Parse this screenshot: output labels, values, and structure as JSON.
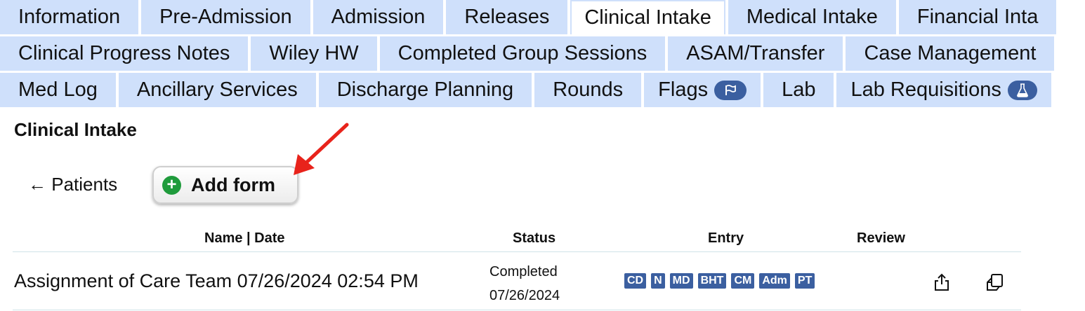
{
  "tabs": {
    "row1": [
      {
        "label": "Information"
      },
      {
        "label": "Pre-Admission"
      },
      {
        "label": "Admission"
      },
      {
        "label": "Releases"
      },
      {
        "label": "Clinical Intake",
        "active": true
      },
      {
        "label": "Medical Intake"
      },
      {
        "label": "Financial Inta"
      }
    ],
    "row2": [
      {
        "label": "Clinical Progress Notes"
      },
      {
        "label": "Wiley HW"
      },
      {
        "label": "Completed Group Sessions"
      },
      {
        "label": "ASAM/Transfer"
      },
      {
        "label": "Case Management"
      }
    ],
    "row3": [
      {
        "label": "Med Log"
      },
      {
        "label": "Ancillary Services"
      },
      {
        "label": "Discharge Planning"
      },
      {
        "label": "Rounds"
      },
      {
        "label": "Flags",
        "badge_icon": "flag-icon"
      },
      {
        "label": "Lab"
      },
      {
        "label": "Lab Requisitions",
        "badge_icon": "flask-icon"
      }
    ]
  },
  "page": {
    "title": "Clinical Intake",
    "back_link": "← Patients",
    "add_form_label": "Add form",
    "add_form_icon": "plus-circle-icon"
  },
  "table": {
    "headers": {
      "name_date": "Name | Date",
      "status": "Status",
      "entry": "Entry",
      "review": "Review"
    },
    "rows": [
      {
        "name": "Assignment of Care Team 07/26/2024 02:54 PM",
        "status": "Completed",
        "status_date": "07/26/2024",
        "entry_badges": [
          "CD",
          "N",
          "MD",
          "BHT",
          "CM",
          "Adm",
          "PT"
        ],
        "actions": [
          "share-icon",
          "copy-icon"
        ]
      }
    ]
  },
  "colors": {
    "tab_bg": "#cfe0fb",
    "badge_bg": "#3b5fa0",
    "add_icon": "#1f9b3c",
    "annotation_arrow": "#e8231b",
    "divider": "#cfe3e8"
  }
}
